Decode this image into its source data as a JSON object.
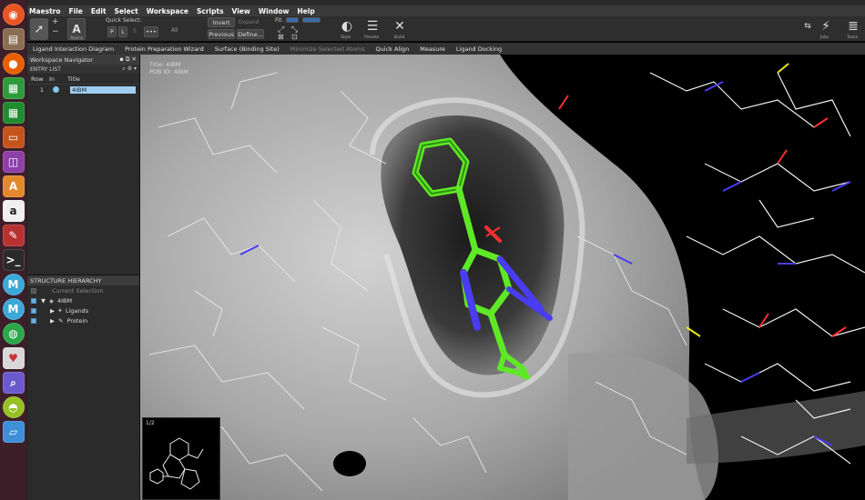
{
  "menu": [
    "Maestro",
    "File",
    "Edit",
    "Select",
    "Workspace",
    "Scripts",
    "View",
    "Window",
    "Help"
  ],
  "toolbar": {
    "quick_select_label": "Quick Select:",
    "quick_buttons": [
      "P",
      "L",
      "S",
      "•••"
    ],
    "all_label": "All",
    "atoms_label": "Atoms",
    "invert_label": "Invert",
    "expand_label": "Expand",
    "previous_label": "Previous",
    "define_label": "Define...",
    "fit_label": "Fit:",
    "style_label": "Style",
    "presets_label": "Presets",
    "build_label": "Build",
    "jobs_label": "Jobs",
    "tasks_label": "Tasks"
  },
  "favorites": [
    "Ligand Interaction Diagram",
    "Protein Preparation Wizard",
    "Surface (Binding Site)",
    "Minimize Selected Atoms",
    "Quick Align",
    "Measure",
    "Ligand Docking"
  ],
  "navigator": {
    "title": "Workspace Navigator",
    "entry_list_label": "ENTRY LIST",
    "columns": [
      "Row",
      "In",
      "Title"
    ],
    "rows": [
      {
        "row": "1",
        "title": "4IBM"
      }
    ]
  },
  "hierarchy": {
    "title": "STRUCTURE HIERARCHY",
    "current_selection": "Current Selection",
    "items": [
      {
        "label": "4IBM"
      },
      {
        "label": "Ligands"
      },
      {
        "label": "Protein"
      }
    ]
  },
  "workspace": {
    "title_line": "Title: 4IBM",
    "pdb_line": "PDB ID: 4IBM",
    "thumbnail_index": "1/2"
  },
  "colors": {
    "ligand": "#5ee825",
    "nitrogen": "#4a3cf0",
    "oxygen": "#ff3030",
    "sulfur": "#e8e81a",
    "surface": "#b8b8b8"
  }
}
